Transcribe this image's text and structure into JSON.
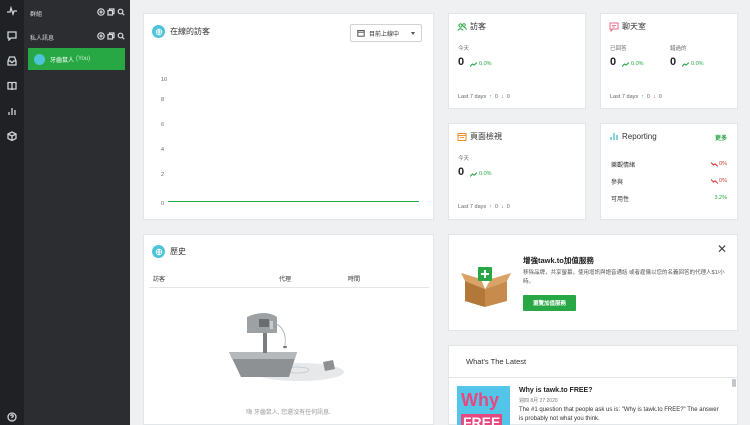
{
  "sidebar": {
    "icons": [
      "activity-icon",
      "chat-bubble-icon",
      "inbox-icon",
      "book-icon",
      "bar-chart-icon",
      "box-icon",
      "help-icon"
    ]
  },
  "chat_panel": {
    "groups_label": "群組",
    "private_label": "私人訊息",
    "agent_name": "牙齒鼠人",
    "agent_you": "(You)"
  },
  "visitors_online": {
    "title": "在線的訪客",
    "filter_label": "目前上線中",
    "y_ticks": [
      "10",
      "8",
      "6",
      "4",
      "2",
      "0"
    ]
  },
  "visitors": {
    "title": "訪客",
    "today_label": "今天",
    "today_value": "0",
    "today_pct": "0.0%",
    "last7_label": "Last 7 days",
    "up": "0",
    "down": "0"
  },
  "chats": {
    "title": "聊天室",
    "served_label": "已回答",
    "served_value": "0",
    "served_pct": "0.0%",
    "missed_label": "錯過的",
    "missed_value": "0",
    "missed_pct": "0.0%",
    "last7_label": "Last 7 days",
    "up": "0",
    "down": "0"
  },
  "page_views": {
    "title": "頁面檢視",
    "today_label": "今天",
    "today_value": "0",
    "today_pct": "0.0%",
    "last7_label": "Last 7 days",
    "up": "0",
    "down": "0"
  },
  "reporting": {
    "title": "Reporting",
    "more_label": "更多",
    "rows": [
      {
        "label": "樂觀情緒",
        "value": "0%"
      },
      {
        "label": "參與",
        "value": "0%"
      },
      {
        "label": "可用性",
        "value": "3.2%"
      }
    ]
  },
  "history": {
    "title": "歷史",
    "col_visitor": "訪客",
    "col_agent": "代理",
    "col_time": "時間",
    "empty_text": "嗨 牙齒鼠人, 您還沒有任何訊息."
  },
  "promo": {
    "title": "增強tawk.to加值服務",
    "desc": "移除品牌，共享螢幕，使用增訊與語音通話 或者雇傭以您的名義回答的代理人$1/小時。",
    "button": "瀏覽加值服務"
  },
  "latest": {
    "title": "What's The Latest",
    "article_title": "Why is tawk.to FREE?",
    "article_date": "週四 8月 27 2020",
    "article_desc": "The #1 question that people ask us is: \"Why is tawk.to FREE?\" The answer is probably not what you think.",
    "thumb_text_1": "Why",
    "thumb_text_2": "FREE"
  },
  "colors": {
    "accent": "#27a844",
    "sidebar_bg": "#1f2124",
    "panel_bg": "#2b2d30",
    "negative": "#d93b3b"
  }
}
